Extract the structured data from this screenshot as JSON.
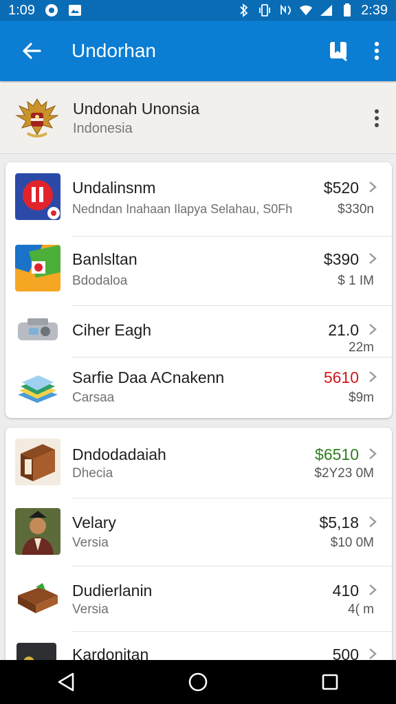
{
  "status_bar": {
    "time_left": "1:09",
    "time_right": "2:39",
    "icons": [
      "record-icon",
      "image-icon",
      "bluetooth-icon",
      "vibrate-icon",
      "nfc-icon",
      "wifi-icon",
      "signal-icon",
      "battery-icon"
    ]
  },
  "app_bar": {
    "title": "Undorhan",
    "back_icon": "arrow-left-icon",
    "actions": [
      "bookmark-icon",
      "overflow-menu-icon"
    ]
  },
  "header": {
    "name": "Undonah Unonsia",
    "country": "Indonesia"
  },
  "groups": [
    {
      "items": [
        {
          "title": "Undalinsnm",
          "subtitle": "Nedndan Inahaan Ilapya Selahau, S0Fh",
          "price": "$520",
          "meta": "$330n",
          "price_color": "#1e1e1e"
        },
        {
          "title": "Banlsltan",
          "subtitle": "Bdodaloa",
          "price": "$390",
          "meta": "$ 1 IM",
          "price_color": "#1e1e1e"
        },
        {
          "title": "Ciher Eagh",
          "subtitle": "",
          "price": "21.0",
          "meta": "22m",
          "price_color": "#1e1e1e"
        },
        {
          "title": "Sarfie Daa ACnakenn",
          "subtitle": "Carsaa",
          "price": "5610",
          "meta": "$9m",
          "price_color": "#d0161b"
        }
      ]
    },
    {
      "items": [
        {
          "title": "Dndodadaiah",
          "subtitle": "Dhecia",
          "price": "$6510",
          "meta": "$2Y23 0M",
          "price_color": "#2e7d1e"
        },
        {
          "title": "Velary",
          "subtitle": "Versia",
          "price": "$5,18",
          "meta": "$10 0M",
          "price_color": "#1e1e1e"
        },
        {
          "title": "Dudierlanin",
          "subtitle": "Versia",
          "price": "410",
          "meta": "4( m",
          "price_color": "#1e1e1e"
        },
        {
          "title": "Kardonitan",
          "subtitle": "",
          "price": "500",
          "meta": "",
          "price_color": "#1e1e1e"
        }
      ]
    }
  ],
  "nav_bar": {
    "buttons": [
      "back-triangle-icon",
      "home-circle-icon",
      "recents-square-icon"
    ]
  },
  "colors": {
    "status_bar": "#0a6cb5",
    "app_bar": "#0b7dd2",
    "header_bg": "#f2f0ec",
    "page_bg": "#ededed"
  }
}
